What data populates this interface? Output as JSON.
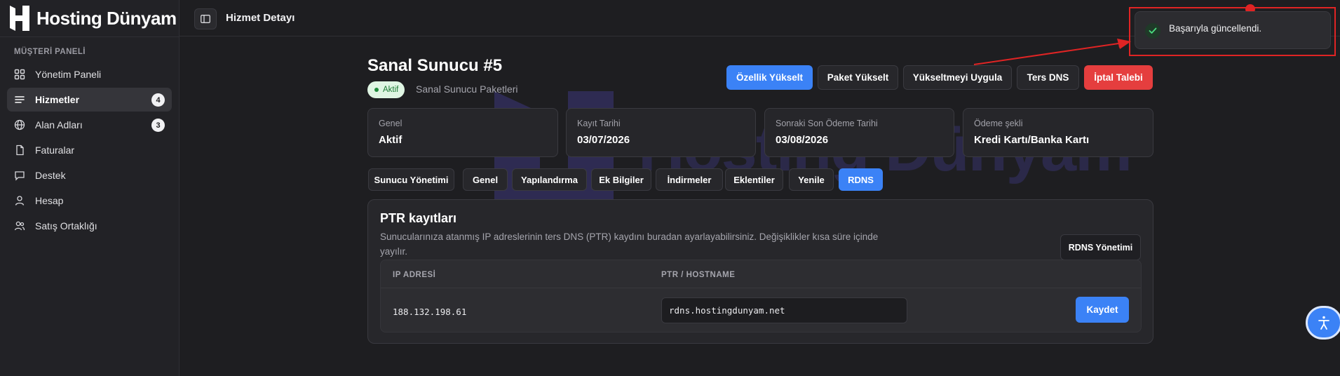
{
  "brand": {
    "name": "Hosting Dünyam"
  },
  "sidebar": {
    "section_label": "MÜŞTERİ PANELİ",
    "items": [
      {
        "label": "Yönetim Paneli",
        "icon": "grid-icon",
        "badge": ""
      },
      {
        "label": "Hizmetler",
        "icon": "list-icon",
        "badge": "4",
        "active": true
      },
      {
        "label": "Alan Adları",
        "icon": "globe-icon",
        "badge": "3"
      },
      {
        "label": "Faturalar",
        "icon": "file-icon",
        "badge": ""
      },
      {
        "label": "Destek",
        "icon": "chat-icon",
        "badge": ""
      },
      {
        "label": "Hesap",
        "icon": "user-icon",
        "badge": ""
      },
      {
        "label": "Satış Ortaklığı",
        "icon": "users-icon",
        "badge": ""
      }
    ]
  },
  "header": {
    "title": "Hizmet Detayı"
  },
  "service": {
    "title": "Sanal Sunucu #5",
    "status": "Aktif",
    "package": "Sanal Sunucu Paketleri"
  },
  "actions": {
    "upgrade_features": "Özellik Yükselt",
    "upgrade_package": "Paket Yükselt",
    "apply_upgrade": "Yükseltmeyi Uygula",
    "reverse_dns": "Ters DNS",
    "cancel_request": "İptal Talebi"
  },
  "info_cards": [
    {
      "label": "Genel",
      "value": "Aktif"
    },
    {
      "label": "Kayıt Tarihi",
      "value": "03/07/2026"
    },
    {
      "label": "Sonraki Son Ödeme Tarihi",
      "value": "03/08/2026"
    },
    {
      "label": "Ödeme şekli",
      "value": "Kredi Kartı/Banka Kartı"
    }
  ],
  "tabs": [
    {
      "label": "Sunucu Yönetimi"
    },
    {
      "label": "Genel"
    },
    {
      "label": "Yapılandırma"
    },
    {
      "label": "Ek Bilgiler"
    },
    {
      "label": "İndirmeler"
    },
    {
      "label": "Eklentiler"
    },
    {
      "label": "Yenile"
    },
    {
      "label": "RDNS",
      "active": true
    }
  ],
  "ptr": {
    "title": "PTR kayıtları",
    "description": "Sunucularınıza atanmış IP adreslerinin ters DNS (PTR) kaydını buradan ayarlayabilirsiniz. Değişiklikler kısa süre içinde yayılır.",
    "manage_button": "RDNS Yönetimi",
    "columns": [
      "IP ADRESİ",
      "PTR / HOSTNAME"
    ],
    "rows": [
      {
        "ip": "188.132.198.61",
        "hostname": "rdns.hostingdunyam.net"
      }
    ],
    "save_button": "Kaydet"
  },
  "toast": {
    "message": "Başarıyla güncellendi."
  },
  "colors": {
    "accent": "#3b82f6",
    "danger": "#e53e3e",
    "success": "#1e8a3a",
    "annotation": "#e02424"
  }
}
